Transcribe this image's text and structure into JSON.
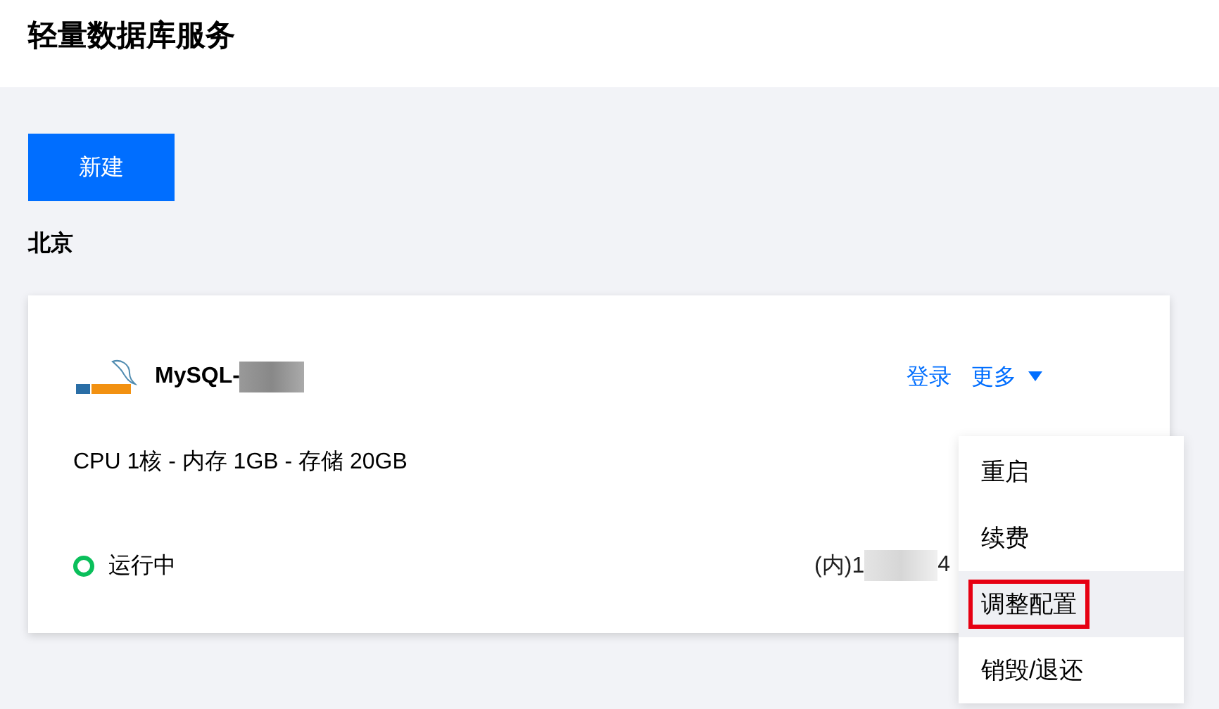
{
  "page": {
    "title": "轻量数据库服务"
  },
  "create_button": {
    "label": "新建"
  },
  "region": "北京",
  "instance": {
    "name": "MySQL-",
    "name_redacted": true,
    "actions": [
      {
        "label": "登录",
        "kind": "link"
      },
      {
        "label": "更多",
        "kind": "dropdown",
        "expanded": true
      }
    ],
    "spec": "CPU 1核 - 内存 1GB - 存储 20GB",
    "status": {
      "label": "运行中",
      "color": "#0abf5b"
    },
    "address_prefix": "(内)1",
    "address_suffix": "4"
  },
  "menu": [
    {
      "label": "重启",
      "highlighted": false,
      "marked": false
    },
    {
      "label": "续费",
      "highlighted": false,
      "marked": false
    },
    {
      "label": "调整配置",
      "highlighted": true,
      "marked": true
    },
    {
      "label": "销毁/退还",
      "highlighted": false,
      "marked": false
    }
  ]
}
